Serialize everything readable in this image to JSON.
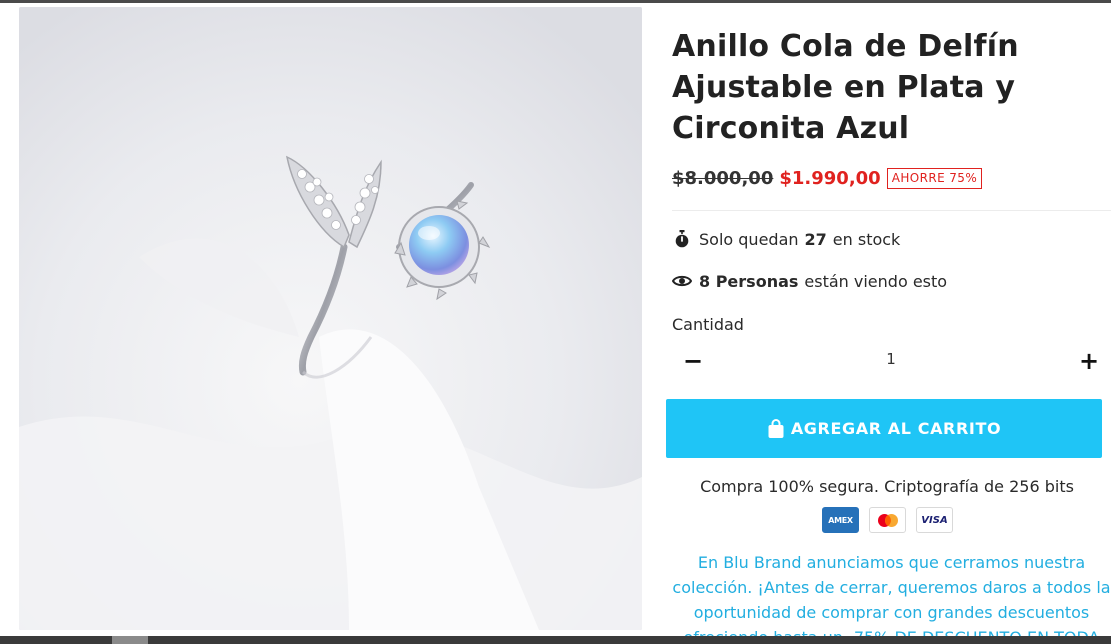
{
  "product": {
    "title": "Anillo Cola de Delfín Ajustable en Plata y Circonita Azul",
    "old_price": "$8.000,00",
    "new_price": "$1.990,00",
    "save_badge": "AHORRE 75%",
    "stock": {
      "prefix": "Solo quedan",
      "count": "27",
      "suffix": "en stock",
      "icon": "stopwatch-icon"
    },
    "viewers": {
      "count_label": "8 Personas",
      "suffix": "están viendo esto",
      "icon": "eye-icon"
    },
    "quantity": {
      "label": "Cantidad",
      "value": "1",
      "minus": "−",
      "plus": "+"
    },
    "cart_button": {
      "label": "AGREGAR AL CARRITO",
      "icon": "shopping-bag-icon"
    },
    "secure_text": "Compra 100% segura. Criptografía de 256 bits",
    "payment_cards": [
      {
        "name": "amex",
        "label": "AMEX"
      },
      {
        "name": "mastercard",
        "label": ""
      },
      {
        "name": "visa",
        "label": "VISA"
      }
    ],
    "promo_text": "En Blu Brand anunciamos que cerramos nuestra colección. ¡Antes de cerrar, queremos daros a todos la oportunidad de comprar con grandes descuentos ofreciendo hasta un -75% DE DESCUENTO EN TODA"
  },
  "colors": {
    "accent": "#1fc5f6",
    "sale_red": "#e0221f",
    "promo_text": "#22aee0",
    "amex_blue": "#2671b9",
    "visa_navy": "#1a1f71"
  }
}
